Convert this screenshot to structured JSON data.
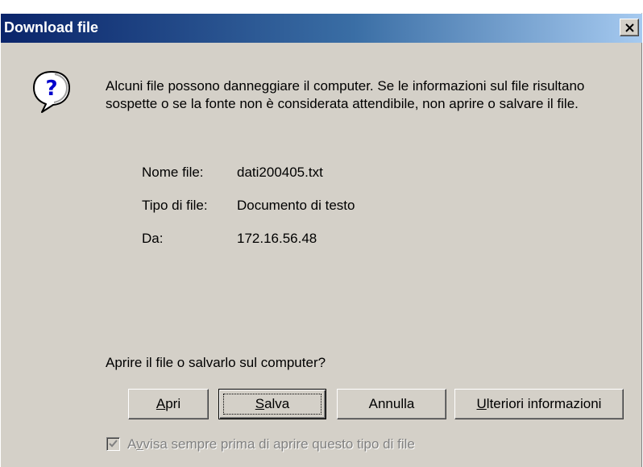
{
  "window": {
    "title": "Download file",
    "close_icon": "close-icon"
  },
  "message": {
    "icon": "question-icon",
    "text": "Alcuni file possono danneggiare il computer. Se le informazioni sul file risultano sospette o se la fonte non è considerata attendibile, non aprire o salvare il file."
  },
  "file_info": {
    "name_label": "Nome file:",
    "name_value": "dati200405.txt",
    "type_label": "Tipo di file:",
    "type_value": "Documento di testo",
    "from_label": "Da:",
    "from_value": "172.16.56.48"
  },
  "prompt": "Aprire il file o salvarlo sul computer?",
  "buttons": {
    "open": {
      "pre": "",
      "u": "A",
      "post": "pri"
    },
    "save": {
      "pre": "",
      "u": "S",
      "post": "alva"
    },
    "cancel": "Annulla",
    "more_info": {
      "pre": "",
      "u": "U",
      "post": "lteriori informazioni"
    }
  },
  "always_ask": {
    "checked": true,
    "enabled": false,
    "label_pre": "A",
    "label_u": "v",
    "label_post": "visa sempre prima di aprire questo tipo di file"
  },
  "colors": {
    "face": "#d4d0c8",
    "title_start": "#0a246a",
    "title_end": "#a6caf0"
  }
}
